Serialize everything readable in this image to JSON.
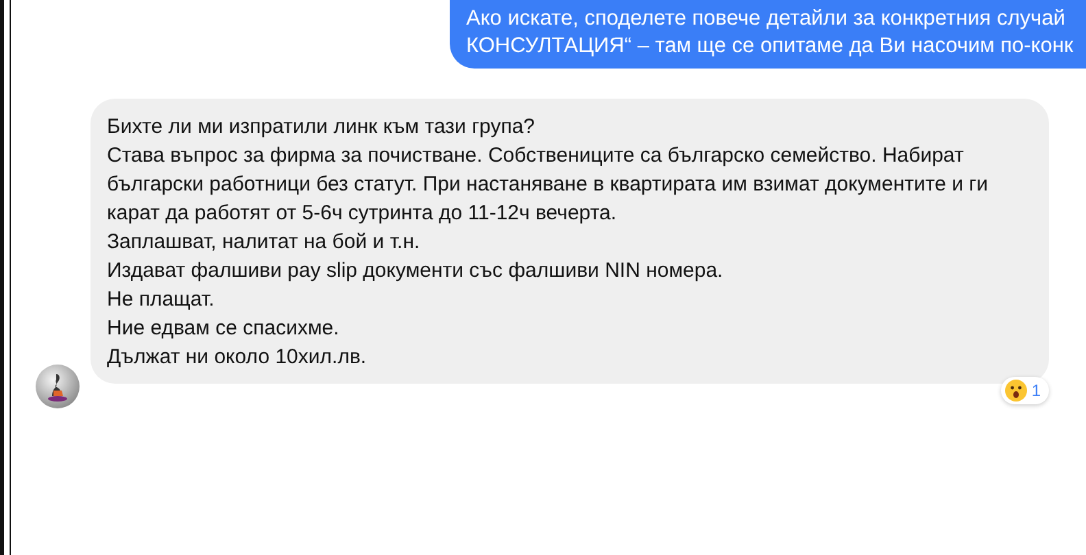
{
  "outgoing_message": {
    "lines": [
      "Ако искате, споделете повече детайли за конкретния случай",
      "КОНСУЛТАЦИЯ“ – там ще се опитаме да Ви насочим по-конк"
    ]
  },
  "incoming_message": {
    "lines": [
      "Бихте ли ми изпратили линк към тази група?",
      "Става въпрос за фирма за почистване. Собствениците са българско семейство. Набират български работници без статут. При настаняване в квартирата им взимат документите и ги карат да работят от 5-6ч сутринта до 11-12ч вечерта.",
      "Заплашват, налитат на бой и т.н.",
      "Издават фалшиви pay slip документи със фалшиви NIN номера.",
      "Не плащат.",
      "Ние едвам се спасихме.",
      "Дължат ни около 10хил.лв."
    ],
    "reaction": {
      "count": "1"
    }
  }
}
